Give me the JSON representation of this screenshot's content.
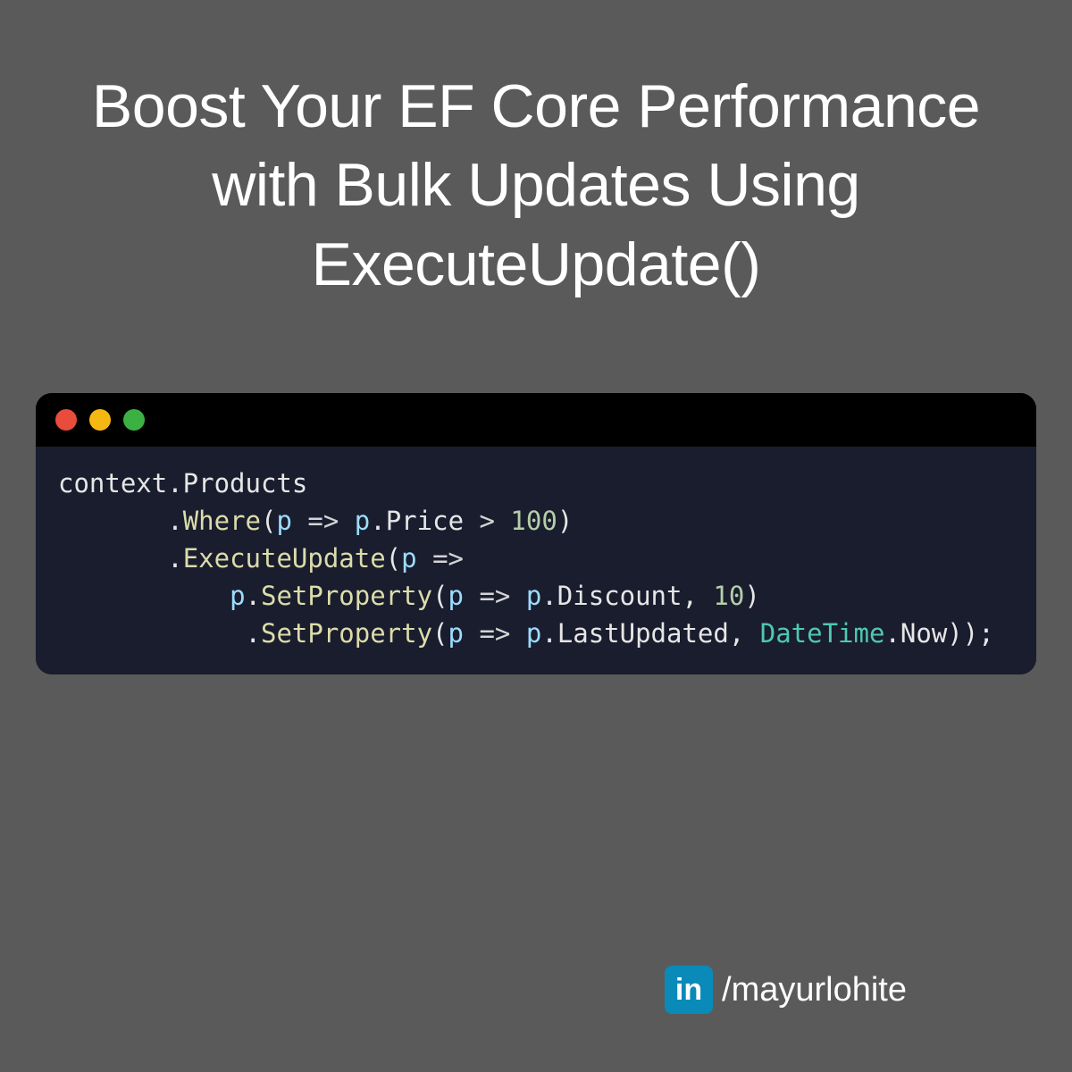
{
  "title": "Boost Your EF Core Performance with Bulk Updates Using ExecuteUpdate()",
  "code": {
    "tokens": [
      [
        {
          "t": "plain",
          "v": "context.Products"
        }
      ],
      [
        {
          "t": "plain",
          "v": "       ."
        },
        {
          "t": "method",
          "v": "Where"
        },
        {
          "t": "plain",
          "v": "("
        },
        {
          "t": "param",
          "v": "p"
        },
        {
          "t": "plain",
          "v": " "
        },
        {
          "t": "op",
          "v": "=>"
        },
        {
          "t": "plain",
          "v": " "
        },
        {
          "t": "param",
          "v": "p"
        },
        {
          "t": "plain",
          "v": ".Price "
        },
        {
          "t": "op",
          "v": ">"
        },
        {
          "t": "plain",
          "v": " "
        },
        {
          "t": "num",
          "v": "100"
        },
        {
          "t": "plain",
          "v": ")"
        }
      ],
      [
        {
          "t": "plain",
          "v": "       ."
        },
        {
          "t": "method",
          "v": "ExecuteUpdate"
        },
        {
          "t": "plain",
          "v": "("
        },
        {
          "t": "param",
          "v": "p"
        },
        {
          "t": "plain",
          "v": " "
        },
        {
          "t": "op",
          "v": "=>"
        }
      ],
      [
        {
          "t": "plain",
          "v": "           "
        },
        {
          "t": "param",
          "v": "p"
        },
        {
          "t": "plain",
          "v": "."
        },
        {
          "t": "method",
          "v": "SetProperty"
        },
        {
          "t": "plain",
          "v": "("
        },
        {
          "t": "param",
          "v": "p"
        },
        {
          "t": "plain",
          "v": " "
        },
        {
          "t": "op",
          "v": "=>"
        },
        {
          "t": "plain",
          "v": " "
        },
        {
          "t": "param",
          "v": "p"
        },
        {
          "t": "plain",
          "v": ".Discount, "
        },
        {
          "t": "num",
          "v": "10"
        },
        {
          "t": "plain",
          "v": ")"
        }
      ],
      [
        {
          "t": "plain",
          "v": "            ."
        },
        {
          "t": "method",
          "v": "SetProperty"
        },
        {
          "t": "plain",
          "v": "("
        },
        {
          "t": "param",
          "v": "p"
        },
        {
          "t": "plain",
          "v": " "
        },
        {
          "t": "op",
          "v": "=>"
        },
        {
          "t": "plain",
          "v": " "
        },
        {
          "t": "param",
          "v": "p"
        },
        {
          "t": "plain",
          "v": ".LastUpdated, "
        },
        {
          "t": "type",
          "v": "DateTime"
        },
        {
          "t": "plain",
          "v": ".Now));"
        }
      ]
    ]
  },
  "footer": {
    "icon_text": "in",
    "handle": "/mayurlohite"
  }
}
